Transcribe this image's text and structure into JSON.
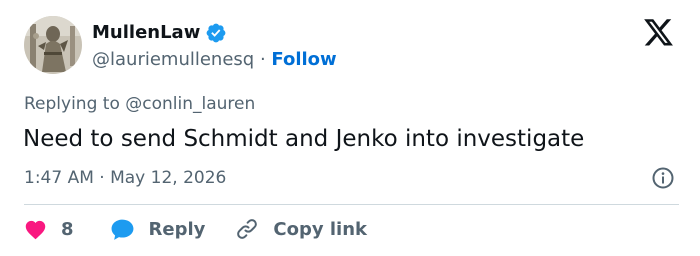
{
  "tweet": {
    "author": {
      "display_name": "MullenLaw",
      "handle": "@lauriemullenesq",
      "separator": " · ",
      "follow_label": "Follow",
      "verified": true
    },
    "reply_context": {
      "prefix": "Replying to ",
      "mention": "@conlin_lauren"
    },
    "text": "Need to send Schmidt and Jenko into investigate",
    "timestamp": "1:47 AM · May 12, 2026",
    "actions": {
      "like_count": "8",
      "reply_label": "Reply",
      "copy_label": "Copy link"
    }
  },
  "icons": {
    "brand": "x-logo-icon",
    "verified": "verified-badge-icon",
    "info": "info-icon",
    "like": "heart-icon",
    "reply": "speech-bubble-icon",
    "copy": "link-icon"
  },
  "colors": {
    "text_primary": "#0f1419",
    "text_secondary": "#536471",
    "link_blue": "#006fd6",
    "verified_blue": "#1d9bf0",
    "like_pink": "#f91880",
    "divider": "#cfd9de"
  }
}
